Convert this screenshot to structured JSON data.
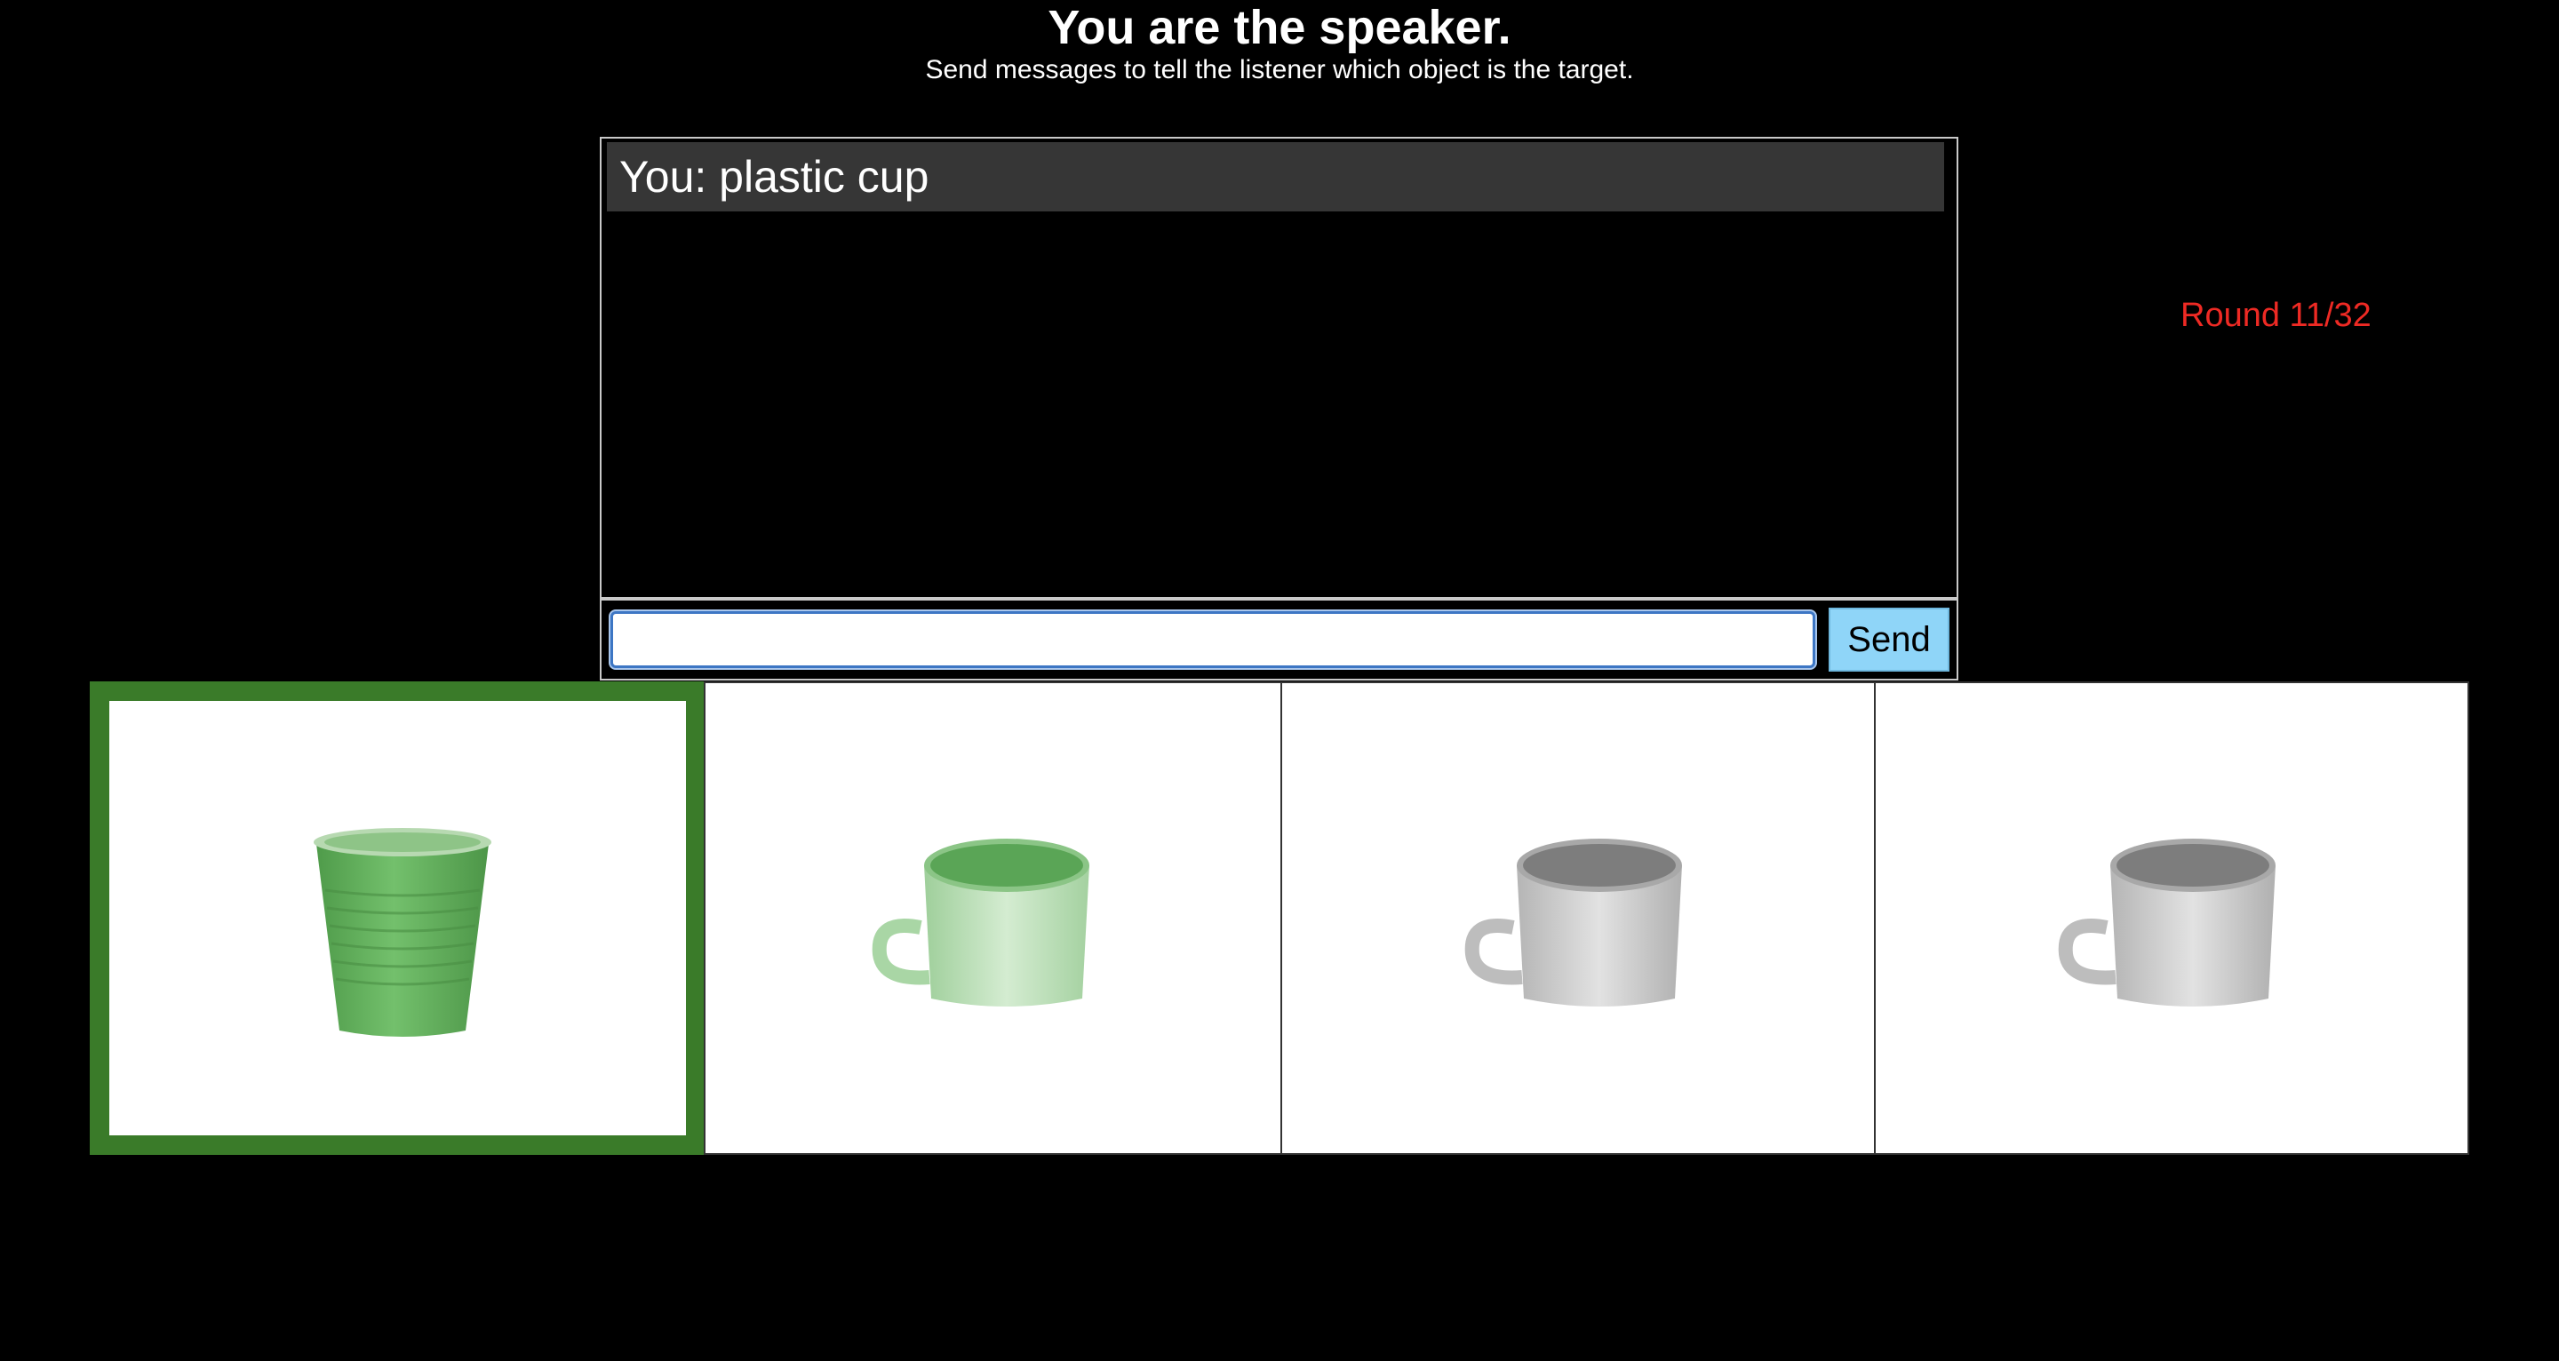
{
  "header": {
    "title": "You are the speaker.",
    "subtitle": "Send messages to tell the listener which object is the target."
  },
  "chat": {
    "messages": [
      {
        "text": "You: plastic cup"
      }
    ],
    "input_value": "",
    "input_placeholder": "",
    "send_label": "Send"
  },
  "round": {
    "label": "Round 11/32"
  },
  "objects": [
    {
      "name": "plastic-cup-icon",
      "color": "#62b15d",
      "is_target": true
    },
    {
      "name": "green-metal-mug-icon",
      "color": "#bfe0bd",
      "is_target": false
    },
    {
      "name": "steel-mug-icon",
      "color": "#c8c8c8",
      "is_target": false
    },
    {
      "name": "steel-mug-icon",
      "color": "#c8c8c8",
      "is_target": false
    }
  ],
  "colors": {
    "background": "#000000",
    "target_border": "#3a7b29",
    "round_text": "#ee2a24",
    "send_button": "#8fd5f8",
    "message_bubble": "#363636"
  }
}
